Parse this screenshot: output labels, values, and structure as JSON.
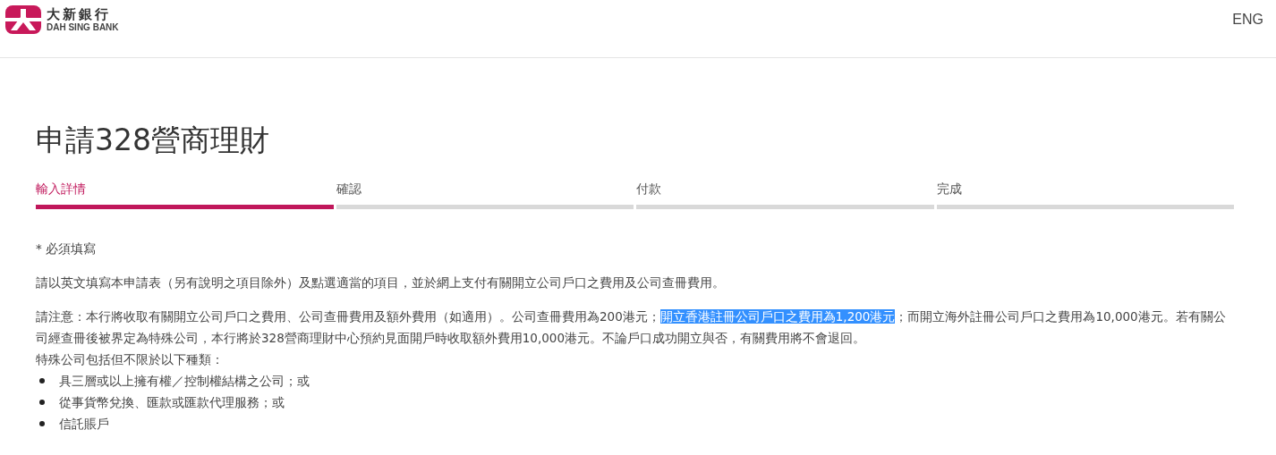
{
  "header": {
    "logo_chinese": "大新銀行",
    "logo_english": "DAH SING BANK",
    "language_link": "ENG"
  },
  "title": "申請328營商理財",
  "steps": [
    {
      "label": "輸入詳情",
      "selected": true
    },
    {
      "label": "確認",
      "selected": false
    },
    {
      "label": "付款",
      "selected": false
    },
    {
      "label": "完成",
      "selected": false
    }
  ],
  "required_note": "* 必須填寫",
  "instruction": "請以英文填寫本申請表（另有說明之項目除外）及點選適當的項目，並於網上支付有關開立公司戶口之費用及公司查冊費用。",
  "notice": {
    "before": "請注意：本行將收取有關開立公司戶口之費用、公司查冊費用及額外費用（如適用）。公司查冊費用為200港元；",
    "selected_text": "開立香港註冊公司戶口之費用為1,200港元",
    "after": "；而開立海外註冊公司戶口之費用為10,000港元。若有關公司經查冊後被界定為特殊公司，本行將於328營商理財中心預約見面開戶時收取額外費用10,000港元。不論戶口成功開立與否，有關費用將不會退回。"
  },
  "special_intro": "特殊公司包括但不限於以下種類：",
  "special_list": [
    "具三層或以上擁有權／控制權結構之公司；或",
    "從事貨幣兌換、匯款或匯款代理服務；或",
    "信託賬戶"
  ]
}
